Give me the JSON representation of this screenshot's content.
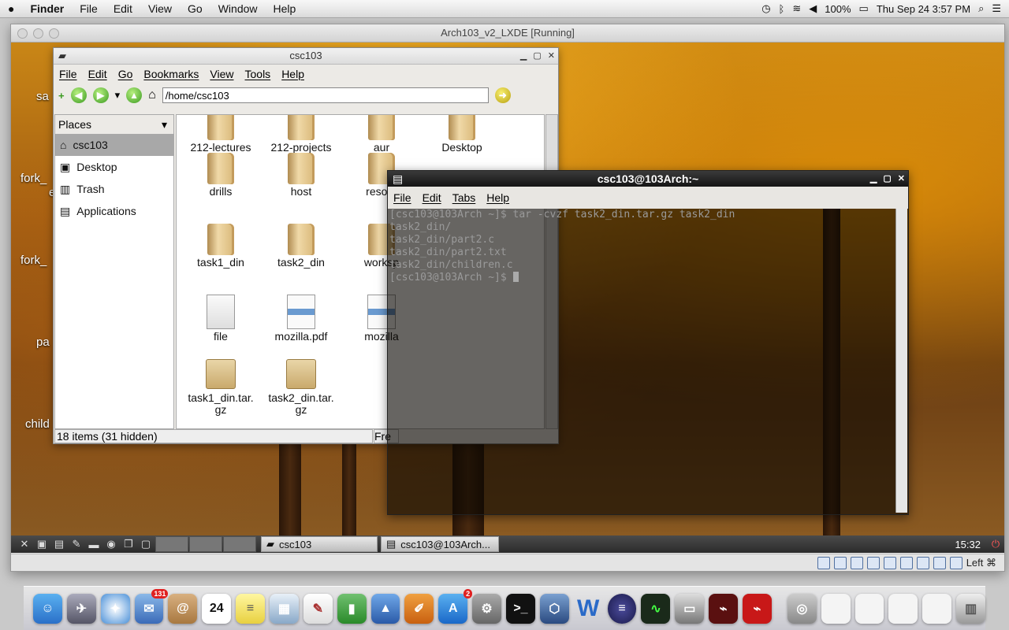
{
  "mac_menubar": {
    "apple": "",
    "app_name": "Finder",
    "menus": [
      "File",
      "Edit",
      "View",
      "Go",
      "Window",
      "Help"
    ],
    "battery": "100%",
    "datetime": "Thu Sep 24  3:57 PM"
  },
  "vbox": {
    "title": "Arch103_v2_LXDE [Running]",
    "host_key": "Left ⌘"
  },
  "desktop_icons": [
    "sa",
    "fork_",
    "e",
    "fork_",
    "pa",
    "child"
  ],
  "file_manager": {
    "title": "csc103",
    "menus": [
      "File",
      "Edit",
      "Go",
      "Bookmarks",
      "View",
      "Tools",
      "Help"
    ],
    "path": "/home/csc103",
    "places_label": "Places",
    "places": [
      {
        "label": "csc103",
        "icon": "home-icon",
        "selected": true
      },
      {
        "label": "Desktop",
        "icon": "desktop-icon",
        "selected": false
      },
      {
        "label": "Trash",
        "icon": "trash-icon",
        "selected": false
      },
      {
        "label": "Applications",
        "icon": "applications-icon",
        "selected": false
      }
    ],
    "files": [
      {
        "name": "212-lectures",
        "kind": "folder"
      },
      {
        "name": "212-projects",
        "kind": "folder"
      },
      {
        "name": "aur",
        "kind": "folder"
      },
      {
        "name": "Desktop",
        "kind": "folder"
      },
      {
        "name": "drills",
        "kind": "folder"
      },
      {
        "name": "host",
        "kind": "folder"
      },
      {
        "name": "resour",
        "kind": "folder"
      },
      {
        "name": "task1_din",
        "kind": "folder"
      },
      {
        "name": "task2_din",
        "kind": "folder"
      },
      {
        "name": "worksp",
        "kind": "folder"
      },
      {
        "name": "file",
        "kind": "document"
      },
      {
        "name": "mozilla.pdf",
        "kind": "pdf"
      },
      {
        "name": "mozilla",
        "kind": "pdf"
      },
      {
        "name": "task1_din.tar.gz",
        "kind": "archive"
      },
      {
        "name": "task2_din.tar.gz",
        "kind": "archive"
      }
    ],
    "status": "18 items (31 hidden)",
    "free_space": "Fre"
  },
  "terminal": {
    "title": "csc103@103Arch:~",
    "menus": [
      "File",
      "Edit",
      "Tabs",
      "Help"
    ],
    "lines": [
      "[csc103@103Arch ~]$ tar -cvzf task2_din.tar.gz task2_din",
      "task2_din/",
      "task2_din/part2.c",
      "task2_din/part2.txt",
      "task2_din/children.c"
    ],
    "prompt": "[csc103@103Arch ~]$ "
  },
  "lxpanel": {
    "tasks": [
      "csc103",
      "csc103@103Arch..."
    ],
    "clock": "15:32"
  },
  "dock": {
    "badges": {
      "mail": "131",
      "calendar": "24",
      "appstore": "2"
    },
    "apps": [
      "finder-icon",
      "launchpad-icon",
      "safari-icon",
      "mail-icon",
      "contacts-icon",
      "calendar-icon",
      "notes-icon",
      "preview-icon",
      "textedit-icon",
      "numbers-icon",
      "keynote-icon",
      "pages-icon",
      "appstore-icon",
      "system-preferences-icon",
      "terminal-icon",
      "virtualbox-icon",
      "word-icon",
      "eclipse-icon",
      "activity-monitor-icon",
      "vbox-vm-icon",
      "acrobat-icon",
      "acrobat-reader-icon",
      "disk-utility-icon",
      "downloads-stack-icon",
      "documents-stack-icon",
      "recent-stack-icon",
      "pdf-stack-icon",
      "trash-icon"
    ]
  },
  "colors": {
    "accent": "#3a9a20",
    "selection": "#a8a8a8",
    "terminal_text": "#9a9a9a"
  }
}
